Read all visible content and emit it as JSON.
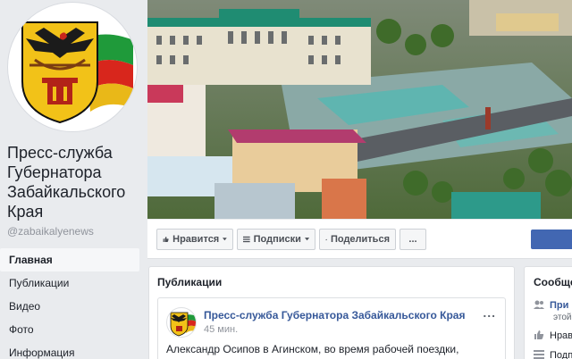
{
  "page": {
    "name": "Пресс-служба Губернатора Забайкальского Края",
    "handle": "@zabaikalyenews"
  },
  "nav": [
    {
      "label": "Главная"
    },
    {
      "label": "Публикации"
    },
    {
      "label": "Видео"
    },
    {
      "label": "Фото"
    },
    {
      "label": "Информация"
    }
  ],
  "actions": {
    "like": "Нравится",
    "follow": "Подписки",
    "share": "Поделиться",
    "more": "..."
  },
  "publications": {
    "title": "Публикации",
    "post": {
      "author": "Пресс-служба Губернатора Забайкальского Края",
      "time": "45 мин.",
      "text": "Александр Осипов в Агинском, во время рабочей поездки,",
      "more": "..."
    }
  },
  "community": {
    "title": "Сообще",
    "row1_link": "При",
    "row1_sub": "этой",
    "row2": "Нрав",
    "row3": "Подп"
  },
  "colors": {
    "brand_blue": "#4267b2",
    "link": "#365899",
    "background": "#e9ebee"
  }
}
